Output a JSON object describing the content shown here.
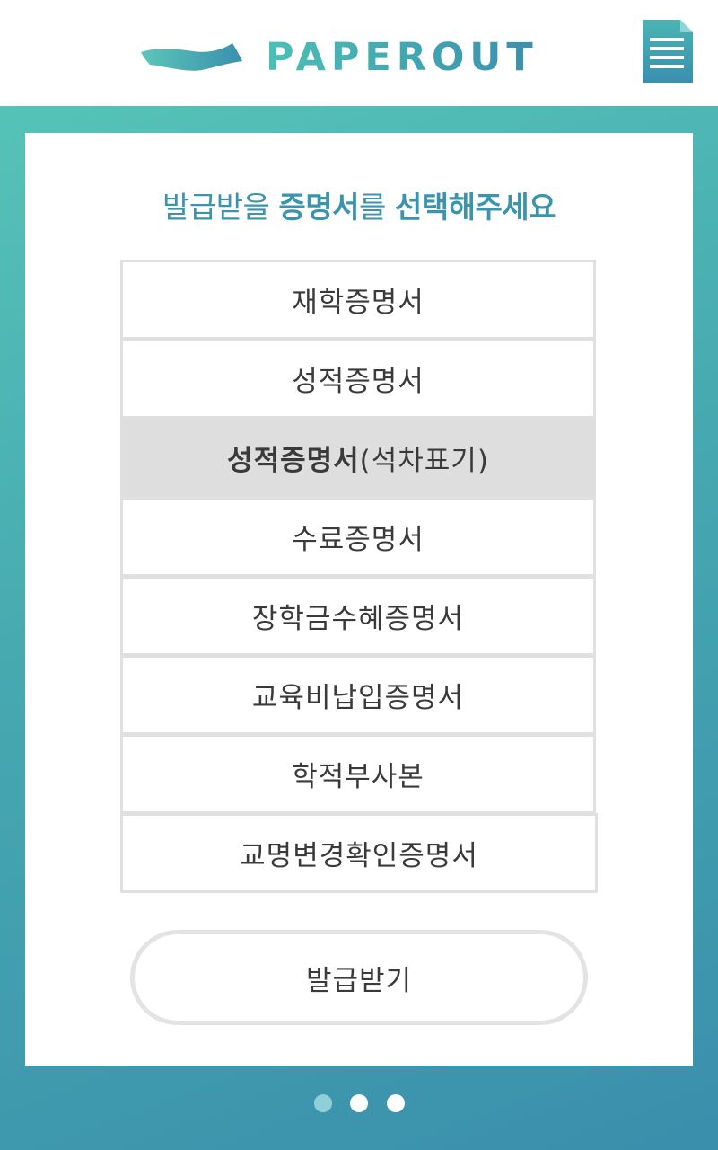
{
  "header": {
    "brand": "PAPEROUT",
    "logo_icon": "wave-icon",
    "menu_icon": "document-menu-icon"
  },
  "prompt": {
    "part1": "발급받을 ",
    "part2": "증명서",
    "part3": "를 ",
    "part4": "선택해주세요"
  },
  "options": [
    {
      "label": "재학증명서"
    },
    {
      "label": "성적증명서"
    },
    {
      "label_bold": "성적증명서",
      "label_rest": "(석차표기)",
      "selected": true
    },
    {
      "label": "수료증명서"
    },
    {
      "label": "장학금수혜증명서"
    },
    {
      "label": "교육비납입증명서"
    },
    {
      "label": "학적부사본"
    },
    {
      "label": "교명변경확인증명서"
    }
  ],
  "issue_button": {
    "label": "발급받기"
  },
  "pager": {
    "count": 3,
    "active_index": 0
  },
  "colors": {
    "accent": "#3a94b0",
    "gradient_start": "#55c3b7",
    "gradient_end": "#3a8fac",
    "selected_bg": "#dedede"
  }
}
